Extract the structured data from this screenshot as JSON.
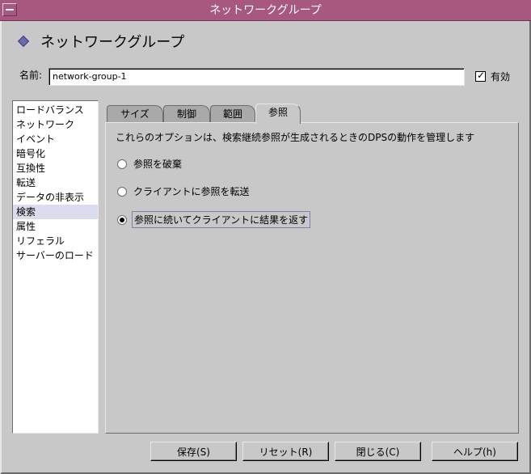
{
  "window": {
    "title": "ネットワークグループ"
  },
  "header": {
    "title": "ネットワークグループ"
  },
  "name": {
    "label": "名前:",
    "value": "network-group-1"
  },
  "enabled": {
    "label": "有効",
    "checked": true
  },
  "sidebar": {
    "items": [
      {
        "label": "ロードバランス"
      },
      {
        "label": "ネットワーク"
      },
      {
        "label": "イベント"
      },
      {
        "label": "暗号化"
      },
      {
        "label": "互換性"
      },
      {
        "label": "転送"
      },
      {
        "label": "データの非表示"
      },
      {
        "label": "検索",
        "selected": true
      },
      {
        "label": "属性"
      },
      {
        "label": "リフェラル"
      },
      {
        "label": "サーバーのロード"
      }
    ]
  },
  "tabs": [
    {
      "label": "サイズ"
    },
    {
      "label": "制御"
    },
    {
      "label": "範囲"
    },
    {
      "label": "参照",
      "active": true
    }
  ],
  "panel": {
    "description": "これらのオプションは、検索継続参照が生成されるときのDPSの動作を管理します",
    "options": [
      {
        "label": "参照を破棄",
        "selected": false
      },
      {
        "label": "クライアントに参照を転送",
        "selected": false
      },
      {
        "label": "参照に続いてクライアントに結果を返す",
        "selected": true
      }
    ]
  },
  "buttons": {
    "save": "保存(S)",
    "reset": "リセット(R)",
    "close": "閉じる(C)",
    "help": "ヘルプ(h)"
  },
  "colors": {
    "titlebar": "#a8577f",
    "window_bg": "#c8c8c8",
    "selection": "#dcdcf0"
  }
}
